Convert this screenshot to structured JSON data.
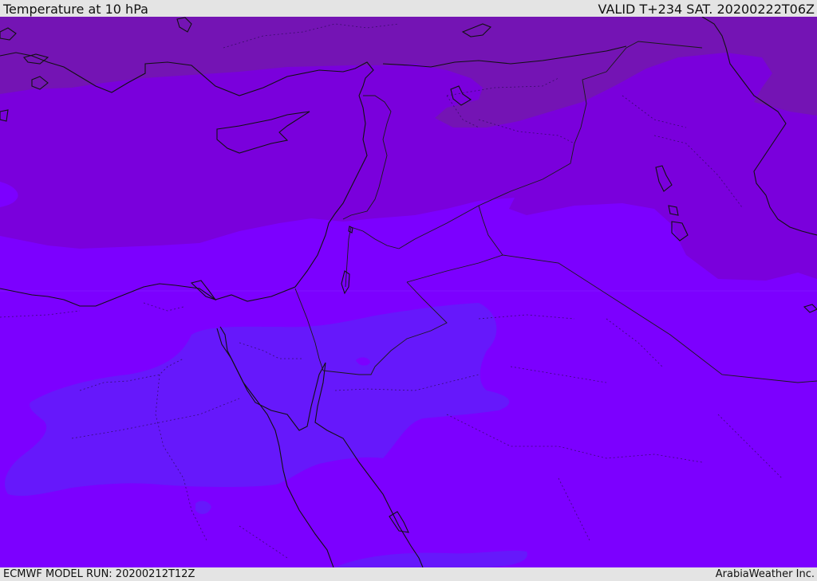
{
  "header": {
    "title": "Temperature at 10 hPa",
    "valid_time": "VALID T+234 SAT. 20200222T06Z"
  },
  "footer": {
    "model_run": "ECMWF MODEL RUN: 20200212T12Z",
    "credit": "ArabiaWeather Inc."
  },
  "colors": {
    "coldest_band": "#7414b4",
    "cold_band": "#7a00dc",
    "mid_band": "#7c00ff",
    "warm_band": "#6618fb",
    "coastline": "#111111",
    "border": "#1a1a1a"
  },
  "map": {
    "region": "Eastern Mediterranean and Middle East",
    "variable": "temperature",
    "level": "10 hPa"
  }
}
